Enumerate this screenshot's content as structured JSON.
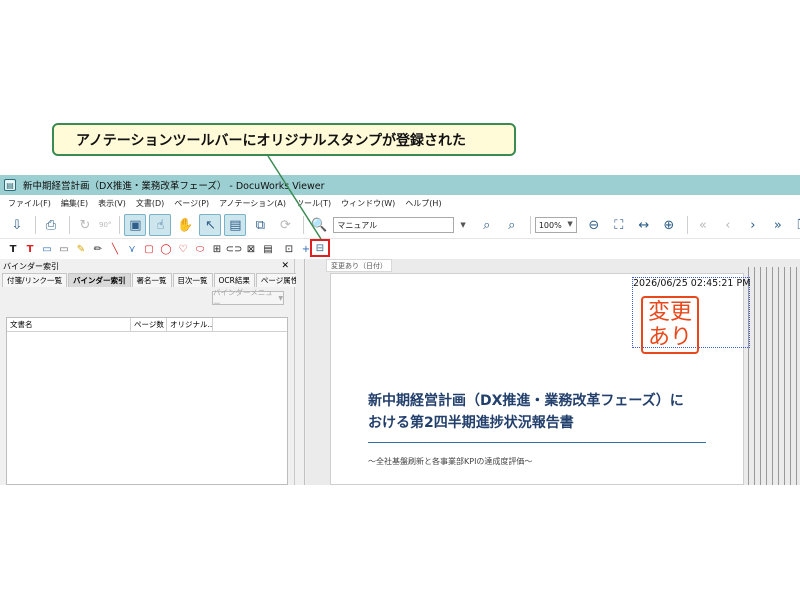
{
  "callout": {
    "text": "アノテーションツールバーにオリジナルスタンプが登録された"
  },
  "window": {
    "title": "新中期経営計画（DX推進・業務改革フェーズ） - DocuWorks Viewer",
    "menu": [
      "ファイル(F)",
      "編集(E)",
      "表示(V)",
      "文書(D)",
      "ページ(P)",
      "アノテーション(A)",
      "ツール(T)",
      "ウィンドウ(W)",
      "ヘルプ(H)"
    ]
  },
  "toolbar": {
    "search_value": "マニュアル",
    "zoom_value": "100%",
    "rotate_label": "90°"
  },
  "annotation_toolbar": {
    "stamp_tooltip": "変更あり（日付）"
  },
  "sidepanel": {
    "title": "バインダー索引",
    "tabs": [
      "付箋/リンク一覧",
      "バインダー索引",
      "署名一覧",
      "目次一覧",
      "OCR結果",
      "ページ属性"
    ],
    "menu_button": "バインダーメニュー",
    "columns": [
      "文書名",
      "ページ数",
      "オリジナル..."
    ]
  },
  "document": {
    "timestamp": "2026/06/25 02:45:21 PM",
    "stamp_line1": "変更",
    "stamp_line2": "あり",
    "title_line1": "新中期経営計画（DX推進・業務改革フェーズ）に",
    "title_line2": "おける第2四半期進捗状況報告書",
    "subtitle": "〜全社基盤刷新と各事業部KPIの達成度評価〜"
  },
  "colors": {
    "titlebar": "#9ccfd1",
    "stamp": "#e8481b",
    "callout_border": "#3a8a52",
    "highlight": "#e02020"
  }
}
